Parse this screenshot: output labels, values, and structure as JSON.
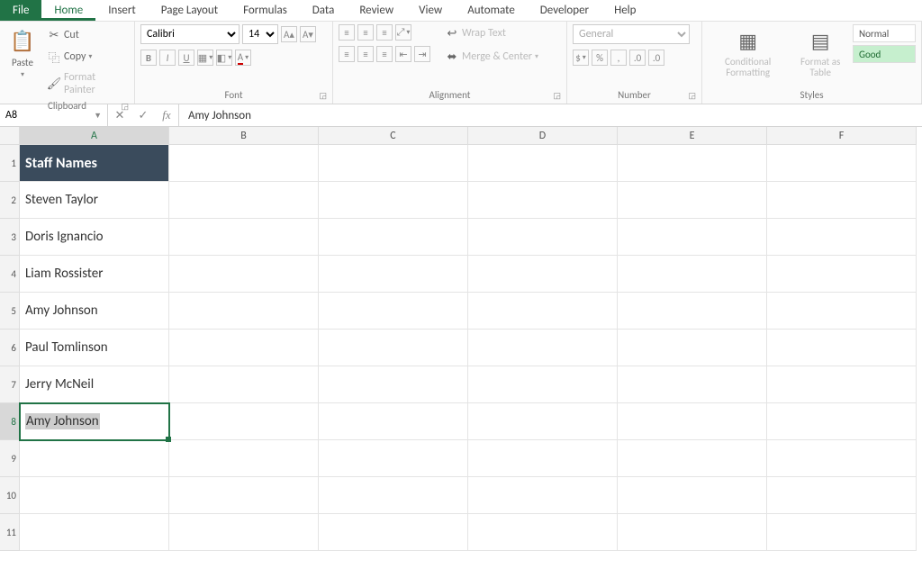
{
  "tabs": {
    "file": "File",
    "list": [
      "Home",
      "Insert",
      "Page Layout",
      "Formulas",
      "Data",
      "Review",
      "View",
      "Automate",
      "Developer",
      "Help"
    ],
    "active": "Home"
  },
  "ribbon": {
    "clipboard": {
      "label": "Clipboard",
      "paste": "Paste",
      "cut": "Cut",
      "copy": "Copy",
      "painter": "Format Painter"
    },
    "font": {
      "label": "Font",
      "name": "Calibri",
      "size": "14"
    },
    "alignment": {
      "label": "Alignment",
      "wrap": "Wrap Text",
      "merge": "Merge & Center"
    },
    "number": {
      "label": "Number",
      "format": "General"
    },
    "styles": {
      "label": "Styles",
      "conditional": "Conditional Formatting",
      "table": "Format as Table",
      "normal": "Normal",
      "good": "Good"
    }
  },
  "namebox": "A8",
  "formula": "Amy Johnson",
  "columns": [
    "A",
    "B",
    "C",
    "D",
    "E",
    "F"
  ],
  "rows": [
    1,
    2,
    3,
    4,
    5,
    6,
    7,
    8,
    9,
    10,
    11
  ],
  "header_cell": "Staff Names",
  "staff": [
    "Steven Taylor",
    "Doris Ignancio",
    "Liam Rossister",
    "Amy Johnson",
    "Paul Tomlinson",
    "Jerry McNeil",
    "Amy Johnson"
  ],
  "selected": {
    "row": 8,
    "col": "A"
  }
}
